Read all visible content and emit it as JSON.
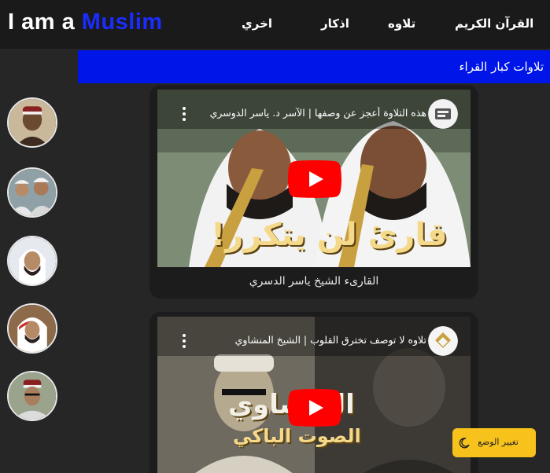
{
  "logo": {
    "prefix": "I am a ",
    "brand": "Muslim"
  },
  "nav": {
    "quran": "القرآن الكريم",
    "recitation": "تلاوه",
    "adhkar": "اذكار",
    "other": "اخري"
  },
  "section": {
    "title": "تلاوات كبار القراء"
  },
  "sidebar": {
    "reciters": [
      {
        "icon": "reciter-avatar-1"
      },
      {
        "icon": "reciter-avatar-2"
      },
      {
        "icon": "reciter-avatar-3"
      },
      {
        "icon": "reciter-avatar-4"
      },
      {
        "icon": "reciter-avatar-5"
      }
    ]
  },
  "videos": [
    {
      "title": "هذه التلاوة أعجز عن وصفها | الآسر د. ياسر الدوسري",
      "overlay": "قارئ لن يتكرر!",
      "channel_icon": "channel-logo-icon",
      "caption": "القارىء الشيخ ياسر الدسري"
    },
    {
      "title": "تلاوه لا توصف تخترق القلوب | الشيخ المنشاوي",
      "overlay_line1": "المنشاوي",
      "overlay_line2": "الصوت الباكي",
      "channel_icon": "channel-logo-icon"
    }
  ],
  "mode_toggle": {
    "label": "تغيير الوضع",
    "icon": "moon-icon"
  },
  "colors": {
    "brand": "#1a2cff",
    "banner": "#0016e8",
    "toggle": "#f6c21b",
    "play": "#ff0000"
  }
}
